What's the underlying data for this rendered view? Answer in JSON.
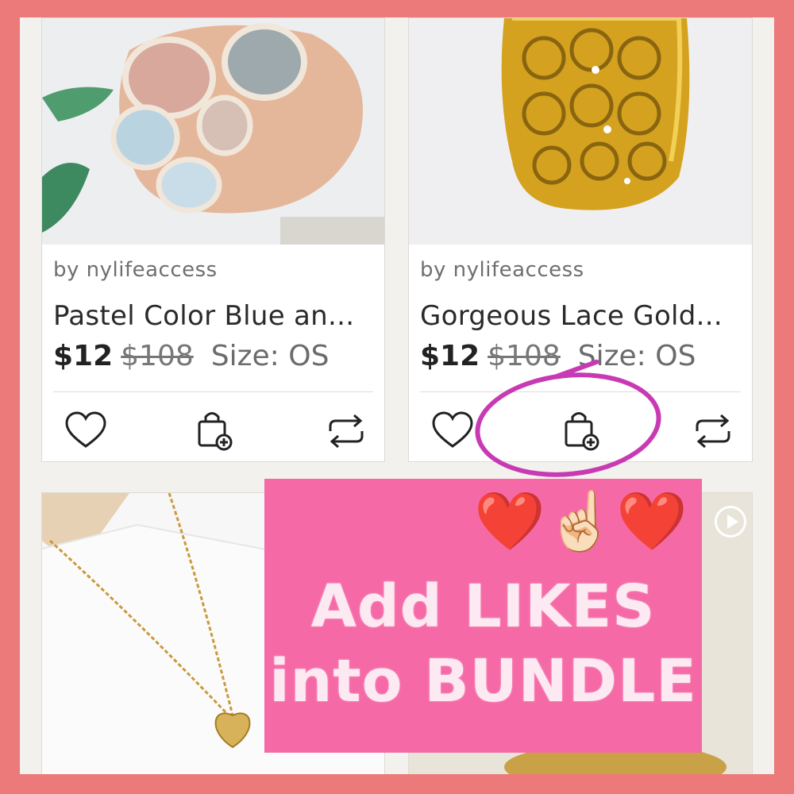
{
  "products": [
    {
      "seller": "by nylifeaccess",
      "title": "Pastel Color Blue an...",
      "price": "$12",
      "original_price": "$108",
      "size": "Size: OS",
      "image_icon": "pastel-ring-photo"
    },
    {
      "seller": "by nylifeaccess",
      "title": "Gorgeous Lace Gold...",
      "price": "$12",
      "original_price": "$108",
      "size": "Size: OS",
      "image_icon": "gold-lace-ring-photo"
    },
    {
      "image_icon": "heart-necklace-photo"
    },
    {
      "image_icon": "gold-ring-photo"
    }
  ],
  "actions": {
    "like_icon": "heart-icon",
    "bundle_icon": "bag-plus-icon",
    "share_icon": "share-icon"
  },
  "banner": {
    "emojis": "❤️☝🏻❤️",
    "line1": "Add LIKES",
    "line2": "into BUNDLE"
  },
  "colors": {
    "outer_frame": "#ec7a7a",
    "background": "#f3f1ed",
    "banner": "#f56aa6",
    "highlight_circle": "#c83ab3"
  }
}
